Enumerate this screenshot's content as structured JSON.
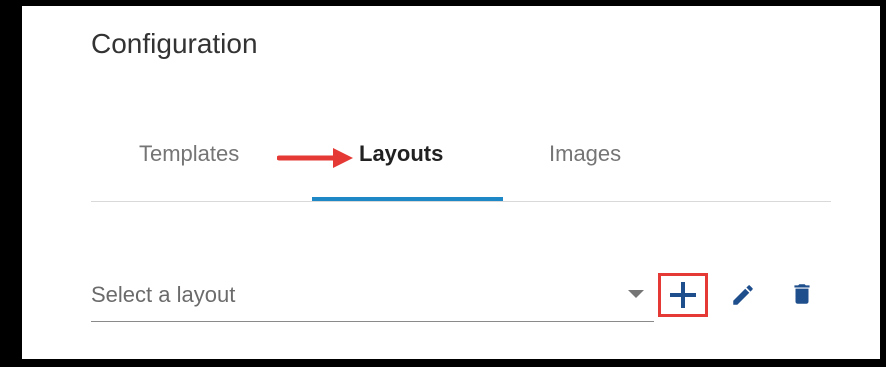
{
  "header": {
    "title": "Configuration"
  },
  "tabs": [
    {
      "label": "Templates",
      "active": false
    },
    {
      "label": "Layouts",
      "active": true
    },
    {
      "label": "Images",
      "active": false
    }
  ],
  "layout_select": {
    "placeholder": "Select a layout",
    "value": ""
  },
  "actions": {
    "add_icon": "plus-icon",
    "edit_icon": "pencil-icon",
    "delete_icon": "trash-icon"
  },
  "colors": {
    "accent": "#1e88c7",
    "icon": "#1f4e8c",
    "highlight_box": "#e53935",
    "annotation_arrow": "#e53935"
  }
}
